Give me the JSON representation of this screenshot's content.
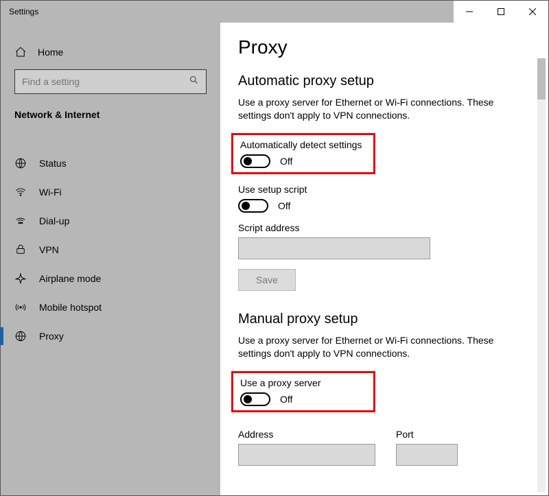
{
  "window": {
    "title": "Settings"
  },
  "sidebar": {
    "home": "Home",
    "search_placeholder": "Find a setting",
    "category": "Network & Internet",
    "items": [
      {
        "label": "Status"
      },
      {
        "label": "Wi-Fi"
      },
      {
        "label": "Dial-up"
      },
      {
        "label": "VPN"
      },
      {
        "label": "Airplane mode"
      },
      {
        "label": "Mobile hotspot"
      },
      {
        "label": "Proxy"
      }
    ]
  },
  "main": {
    "title": "Proxy",
    "auto": {
      "heading": "Automatic proxy setup",
      "desc": "Use a proxy server for Ethernet or Wi-Fi connections. These settings don't apply to VPN connections.",
      "detect_label": "Automatically detect settings",
      "detect_state": "Off",
      "script_label": "Use setup script",
      "script_state": "Off",
      "script_addr_label": "Script address",
      "save": "Save"
    },
    "manual": {
      "heading": "Manual proxy setup",
      "desc": "Use a proxy server for Ethernet or Wi-Fi connections. These settings don't apply to VPN connections.",
      "use_label": "Use a proxy server",
      "use_state": "Off",
      "address_label": "Address",
      "port_label": "Port"
    }
  }
}
